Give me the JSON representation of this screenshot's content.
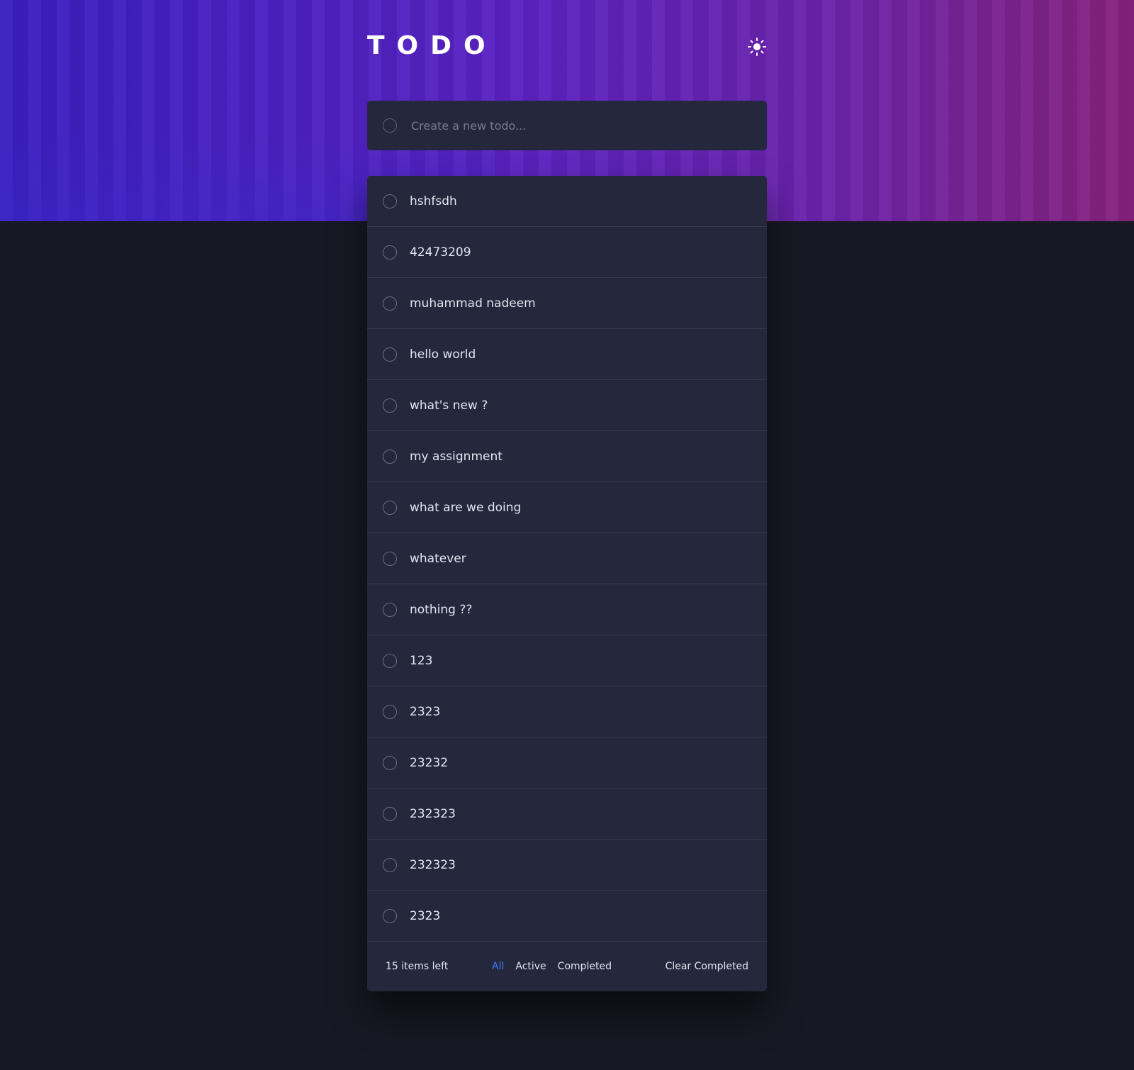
{
  "app": {
    "title": "TODO"
  },
  "theme_toggle": {
    "icon": "sun-icon"
  },
  "new_todo": {
    "placeholder": "Create a new todo..."
  },
  "todos": [
    {
      "text": "hshfsdh"
    },
    {
      "text": "42473209"
    },
    {
      "text": "muhammad nadeem"
    },
    {
      "text": "hello world"
    },
    {
      "text": "what's new ?"
    },
    {
      "text": "my assignment"
    },
    {
      "text": "what are we doing"
    },
    {
      "text": "whatever"
    },
    {
      "text": "nothing ??"
    },
    {
      "text": "123"
    },
    {
      "text": "2323"
    },
    {
      "text": "23232"
    },
    {
      "text": "232323"
    },
    {
      "text": "232323"
    },
    {
      "text": "2323"
    }
  ],
  "footer": {
    "items_left": "15 items left",
    "filters": {
      "all": "All",
      "active": "Active",
      "completed": "Completed"
    },
    "clear_completed": "Clear Completed"
  },
  "colors": {
    "accent": "#3a7cfd",
    "background": "#171823",
    "card": "#25273d"
  }
}
